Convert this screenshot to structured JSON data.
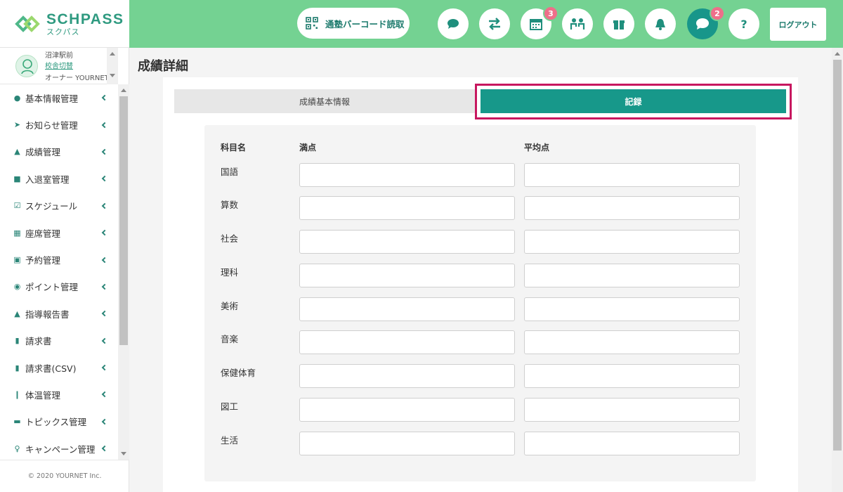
{
  "brand": {
    "name": "SCHPASS",
    "sub": "スクパス"
  },
  "header": {
    "barcode_label": "通塾バーコード読取",
    "logout_label": "ログアウト",
    "calendar_badge": "3",
    "messages_badge": "2",
    "help_label": "?"
  },
  "user": {
    "school": "沼津駅前",
    "switch_label": "校舎切替",
    "role": "オーナー YOURNET"
  },
  "sidebar": {
    "items": [
      {
        "label": "基本情報管理",
        "icon": "person-icon"
      },
      {
        "label": "お知らせ管理",
        "icon": "paper-plane-icon"
      },
      {
        "label": "成績管理",
        "icon": "graduation-cap-icon"
      },
      {
        "label": "入退室管理",
        "icon": "car-icon"
      },
      {
        "label": "スケジュール",
        "icon": "calendar-check-icon"
      },
      {
        "label": "座席管理",
        "icon": "calendar-icon"
      },
      {
        "label": "予約管理",
        "icon": "reservation-icon"
      },
      {
        "label": "ポイント管理",
        "icon": "point-icon"
      },
      {
        "label": "指導報告書",
        "icon": "graduation-cap-icon"
      },
      {
        "label": "請求書",
        "icon": "invoice-icon"
      },
      {
        "label": "請求書(CSV)",
        "icon": "invoice-icon"
      },
      {
        "label": "体温管理",
        "icon": "thermometer-icon"
      },
      {
        "label": "トピックス管理",
        "icon": "book-icon"
      },
      {
        "label": "キャンペーン管理",
        "icon": "campaign-icon"
      }
    ],
    "copyright": "© 2020 YOURNET Inc."
  },
  "page": {
    "title": "成績詳細",
    "tabs": [
      {
        "label": "成績基本情報",
        "active": false
      },
      {
        "label": "記録",
        "active": true
      }
    ]
  },
  "form": {
    "headers": {
      "subject": "科目名",
      "full_score": "満点",
      "average": "平均点"
    },
    "rows": [
      {
        "subject": "国語",
        "full_score": "",
        "average": ""
      },
      {
        "subject": "算数",
        "full_score": "",
        "average": ""
      },
      {
        "subject": "社会",
        "full_score": "",
        "average": ""
      },
      {
        "subject": "理科",
        "full_score": "",
        "average": ""
      },
      {
        "subject": "美術",
        "full_score": "",
        "average": ""
      },
      {
        "subject": "音楽",
        "full_score": "",
        "average": ""
      },
      {
        "subject": "保健体育",
        "full_score": "",
        "average": ""
      },
      {
        "subject": "図工",
        "full_score": "",
        "average": ""
      },
      {
        "subject": "生活",
        "full_score": "",
        "average": ""
      }
    ]
  },
  "colors": {
    "header_bg": "#74d292",
    "accent": "#17988a",
    "highlight": "#c7175f",
    "badge": "#ee6f8a"
  }
}
